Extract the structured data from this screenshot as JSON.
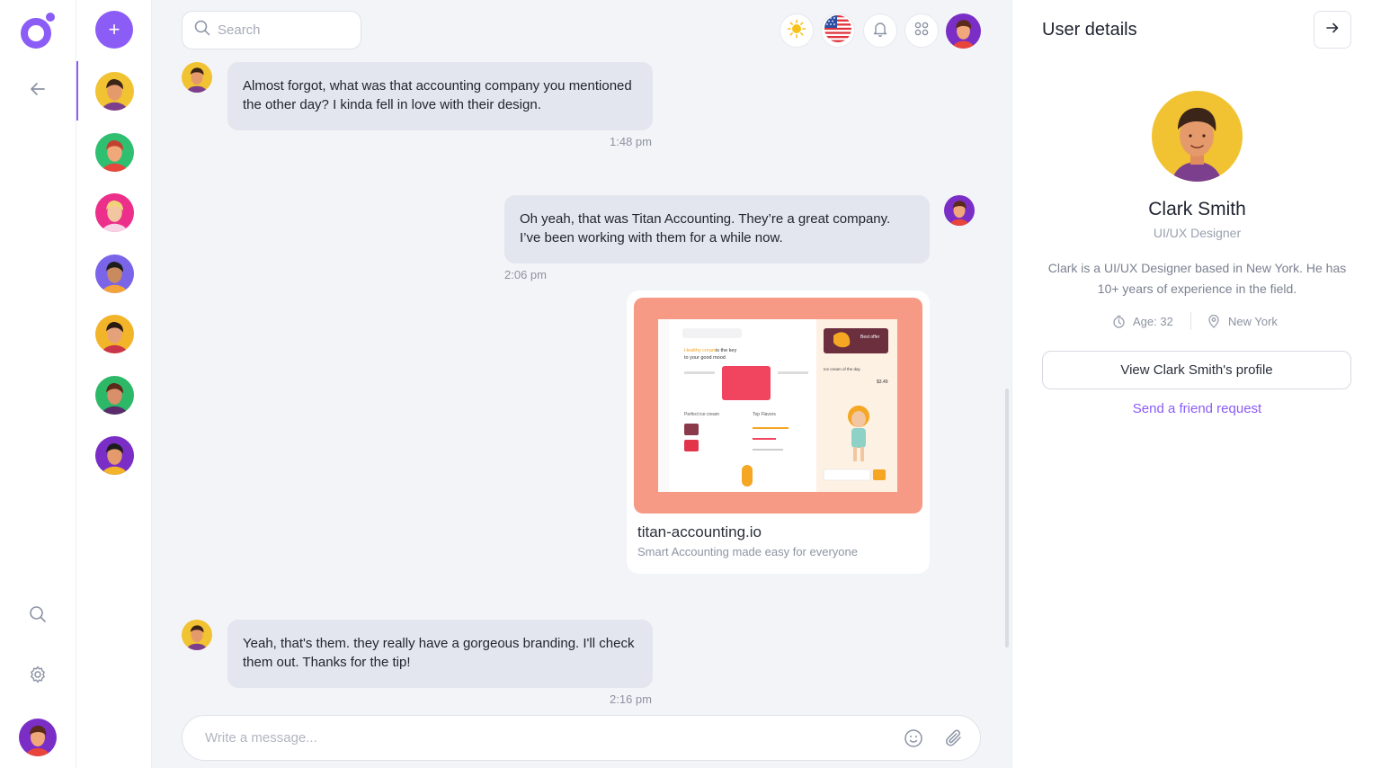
{
  "colors": {
    "accent": "#8b5cf6",
    "bubble": "#e3e6ee",
    "background": "#f3f4f8"
  },
  "rail": {
    "logo": "app-logo",
    "back_icon": "arrow-left-icon",
    "search_icon": "search-icon",
    "settings_icon": "gear-icon"
  },
  "contacts": {
    "add_label": "+",
    "items": [
      {
        "bg": "#f1c232"
      },
      {
        "bg": "#2fbf71"
      },
      {
        "bg": "#ec2f8a"
      },
      {
        "bg": "#7a64e8"
      },
      {
        "bg": "#f2b429"
      },
      {
        "bg": "#2cb867"
      },
      {
        "bg": "#7b2ec6"
      }
    ]
  },
  "header": {
    "search_placeholder": "Search",
    "icons": [
      "sun-icon",
      "us-flag-icon",
      "bell-icon",
      "grid-icon"
    ]
  },
  "messages": [
    {
      "text": "Almost forgot, what was that accounting company you mentioned the other day? I kinda fell in love with their design.",
      "time": "1:48 pm"
    },
    {
      "text": "Oh yeah, that was Titan Accounting. They’re a great company. I’ve been working with them for a while now.",
      "time": "2:06 pm"
    },
    {
      "text": "Yeah, that's them. they really have a gorgeous branding. I'll check them out. Thanks for the tip!",
      "time": "2:16 pm"
    }
  ],
  "link_preview": {
    "title": "titan-accounting.io",
    "description": "Smart Accounting made easy for everyone",
    "preview_texts": {
      "headline_a": "Healthy cream",
      "headline_b": " is the key",
      "headline_c": "to your good mood",
      "offer": "Best offer",
      "of_day": "Ice cream of the day",
      "perfect": "Perfect ice cream",
      "flavors": "Top Flavors",
      "price": "$3.49"
    }
  },
  "composer": {
    "placeholder": "Write a message...",
    "emoji_icon": "smile-icon",
    "attach_icon": "paperclip-icon"
  },
  "panel": {
    "title": "User details",
    "name": "Clark Smith",
    "role": "UI/UX Designer",
    "bio": "Clark is a UI/UX Designer based in New York. He has 10+ years of experience in the field.",
    "age": "Age: 32",
    "location": "New York",
    "profile_button": "View Clark Smith's profile",
    "friend_link": "Send a friend request"
  }
}
